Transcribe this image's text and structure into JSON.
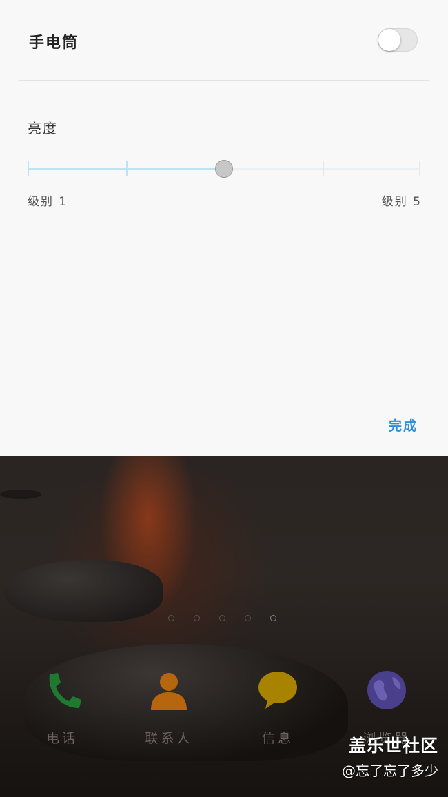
{
  "flashlight": {
    "title": "手电筒",
    "toggle_on": false
  },
  "brightness": {
    "title": "亮度",
    "level_min_label": "级别 1",
    "level_max_label": "级别 5",
    "levels": 5,
    "current_level": 3
  },
  "done_label": "完成",
  "colors": {
    "accent": "#2f8fd6",
    "slider_fill": "#bfe2f3",
    "panel_bg": "#f8f8f8"
  },
  "home": {
    "page_count": 5,
    "active_page": 5,
    "apps": [
      {
        "label": "电话",
        "icon": "phone-icon",
        "color": "#1d7a2e"
      },
      {
        "label": "联系人",
        "icon": "contacts-icon",
        "color": "#b5660f"
      },
      {
        "label": "信息",
        "icon": "message-icon",
        "color": "#a88300"
      },
      {
        "label": "浏览器",
        "icon": "browser-icon",
        "color": "#4a3f8a"
      }
    ]
  },
  "watermark": {
    "title": "盖乐世社区",
    "user": "@忘了忘了多少"
  }
}
